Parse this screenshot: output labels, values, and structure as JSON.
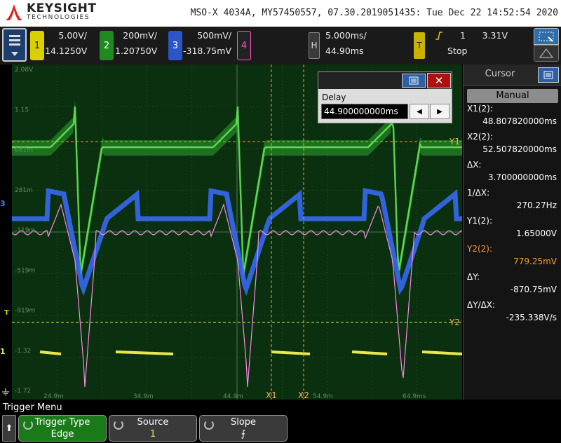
{
  "header": {
    "brand": "KEYSIGHT",
    "brand_sub": "TECHNOLOGIES",
    "scope_info": "MSO-X 4034A, MY57450557, 07.30.2019051435: Tue Dec 22 14:52:54 2020"
  },
  "channels": [
    {
      "id": "1",
      "scale": "5.00V/",
      "offset": "14.1250V",
      "color": "#e8e84a"
    },
    {
      "id": "2",
      "scale": "200mV/",
      "offset": "1.20750V",
      "color": "#58d648"
    },
    {
      "id": "3",
      "scale": "500mV/",
      "offset": "-318.75mV",
      "color": "#4a7bff"
    },
    {
      "id": "4",
      "scale": "",
      "offset": "",
      "color": "#ff55c8"
    }
  ],
  "horizontal": {
    "badge": "H",
    "scale": "5.000ms/",
    "position": "44.90ms"
  },
  "trigger": {
    "badge": "T",
    "slope_icon": "rising-edge-icon",
    "source": "1",
    "level": "3.31V",
    "status": "Stop",
    "color": "#d8c000"
  },
  "delay_dialog": {
    "label": "Delay",
    "value": "44.900000000ms"
  },
  "waveform": {
    "left_labels": [
      "2.08V",
      "1.15",
      "681m",
      "281m",
      "-119m",
      "-519m",
      "-919m",
      "-1.32",
      "-1.72"
    ],
    "time_labels": [
      "24.9m",
      "34.9m",
      "44.9m",
      "54.9m",
      "64.9ms"
    ],
    "cursor_tags": {
      "x1": "X1",
      "x2": "X2",
      "y1": "Y1",
      "y2": "Y2"
    },
    "markers": {
      "ch3": "3",
      "ch1": "1",
      "trig": "T",
      "ground": "G"
    }
  },
  "cursor_panel": {
    "title": "Cursor",
    "mode": "Manual",
    "rows": [
      {
        "label": "X1(2):",
        "value": "48.807820000ms"
      },
      {
        "label": "X2(2):",
        "value": "52.507820000ms"
      },
      {
        "label": "ΔX:",
        "value": "3.700000000ms"
      },
      {
        "label": "1/ΔX:",
        "value": "270.27Hz"
      },
      {
        "label": "Y1(2):",
        "value": "1.65000V"
      },
      {
        "label": "Y2(2):",
        "value": "779.25mV"
      },
      {
        "label": "ΔY:",
        "value": "-870.75mV"
      },
      {
        "label": "ΔY/ΔX:",
        "value": "-235.338V/s"
      }
    ],
    "highlight_color": "#ff9a2a"
  },
  "softkeys": {
    "menu_title": "Trigger Menu",
    "back_icon": "up-arrow-icon",
    "keys": [
      {
        "title": "Trigger Type",
        "value": "Edge"
      },
      {
        "title": "Source",
        "value": "1"
      },
      {
        "title": "Slope",
        "value": "⨍"
      }
    ]
  }
}
